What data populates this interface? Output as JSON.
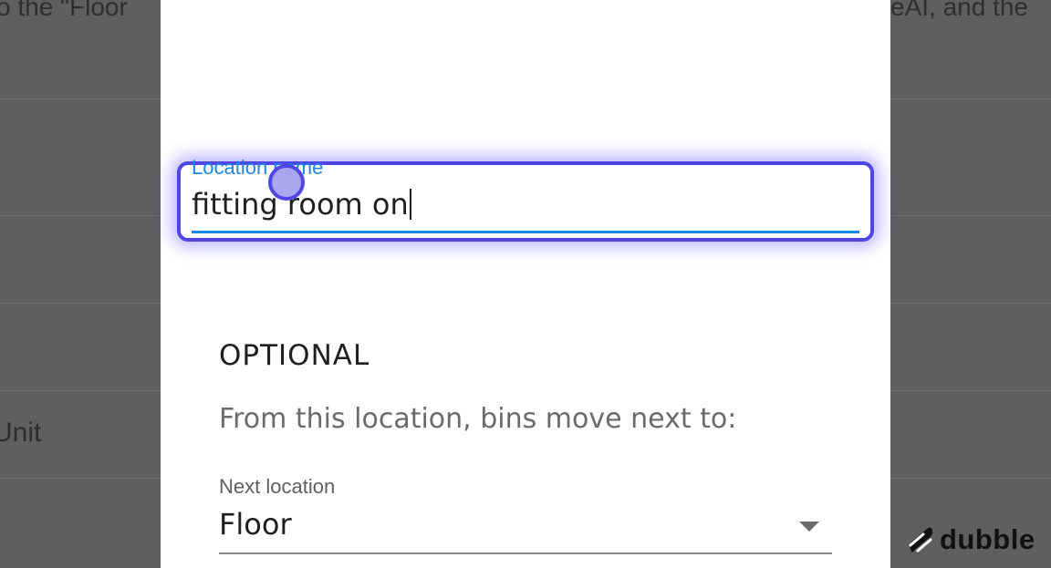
{
  "background": {
    "text_left": "o the \"Floor",
    "text_right": "eAI, and the",
    "unit_label": "Unit"
  },
  "dialog": {
    "location_field": {
      "label": "Location name",
      "value": "fitting room on"
    },
    "optional_section": {
      "title": "OPTIONAL",
      "description": "From this location, bins move next to:"
    },
    "next_location": {
      "label": "Next location",
      "selected": "Floor"
    }
  },
  "brand": {
    "name": "dubble",
    "icon": "dubble-logo-icon"
  },
  "colors": {
    "accent": "#4f46e5",
    "field_blue": "#1e88e5",
    "overlay": "#5f5f5f"
  }
}
